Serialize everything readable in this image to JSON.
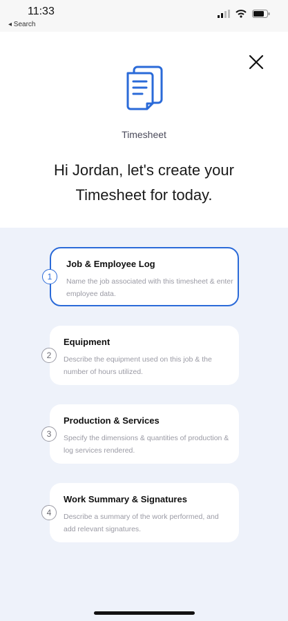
{
  "status": {
    "time": "11:33",
    "back_label": "◂ Search"
  },
  "header": {
    "doc_label": "Timesheet",
    "headline": "Hi Jordan, let's create your Timesheet for today."
  },
  "steps": [
    {
      "number": "1",
      "title": "Job & Employee Log",
      "desc": "Name the job associated with this timesheet & enter employee data."
    },
    {
      "number": "2",
      "title": "Equipment",
      "desc": "Describe the equipment used on this job & the number of hours utilized."
    },
    {
      "number": "3",
      "title": "Production & Services",
      "desc": "Specify the dimensions & quantities of production & log services rendered."
    },
    {
      "number": "4",
      "title": "Work Summary & Signatures",
      "desc": "Describe a summary of the work performed, and add relevant signatures."
    }
  ],
  "colors": {
    "accent": "#2a6ad8",
    "steps_background": "#eef2fa"
  }
}
